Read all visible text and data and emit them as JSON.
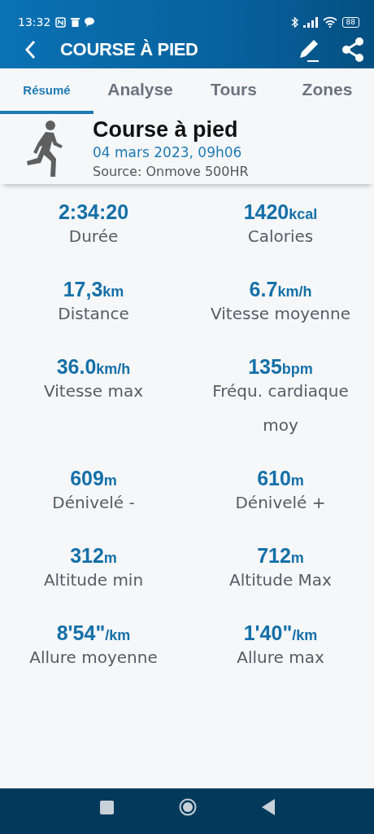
{
  "status_bar": {
    "time": "13:32",
    "battery": "88"
  },
  "header": {
    "title": "COURSE À PIED"
  },
  "tabs": [
    {
      "label": "Résumé",
      "selected": true
    },
    {
      "label": "Analyse",
      "selected": false
    },
    {
      "label": "Tours",
      "selected": false
    },
    {
      "label": "Zones",
      "selected": false
    }
  ],
  "activity": {
    "title": "Course à pied",
    "date": "04 mars 2023, 09h06",
    "source": "Source: Onmove 500HR"
  },
  "stats": [
    {
      "value": "2:34:20",
      "label": "Durée"
    },
    {
      "value": "1420",
      "unit": "kcal",
      "label": "Calories"
    },
    {
      "value": "17,3",
      "unit": "km",
      "label": "Distance"
    },
    {
      "value": "6.7",
      "unit": "km/h",
      "label": "Vitesse moyenne"
    },
    {
      "value": "36.0",
      "unit": "km/h",
      "label": "Vitesse max"
    },
    {
      "value": "135",
      "unit": "bpm",
      "label": "Fréqu. cardiaque moy"
    },
    {
      "value": "609",
      "unit": "m",
      "label": "Dénivelé -"
    },
    {
      "value": "610",
      "unit": "m",
      "label": "Dénivelé +"
    },
    {
      "value": "312",
      "unit": "m",
      "label": "Altitude min"
    },
    {
      "value": "712",
      "unit": "m",
      "label": "Altitude Max"
    },
    {
      "value": "8'54\"",
      "unit": "/km",
      "label": "Allure moyenne"
    },
    {
      "value": "1'40\"",
      "unit": "/km",
      "label": "Allure max"
    }
  ]
}
